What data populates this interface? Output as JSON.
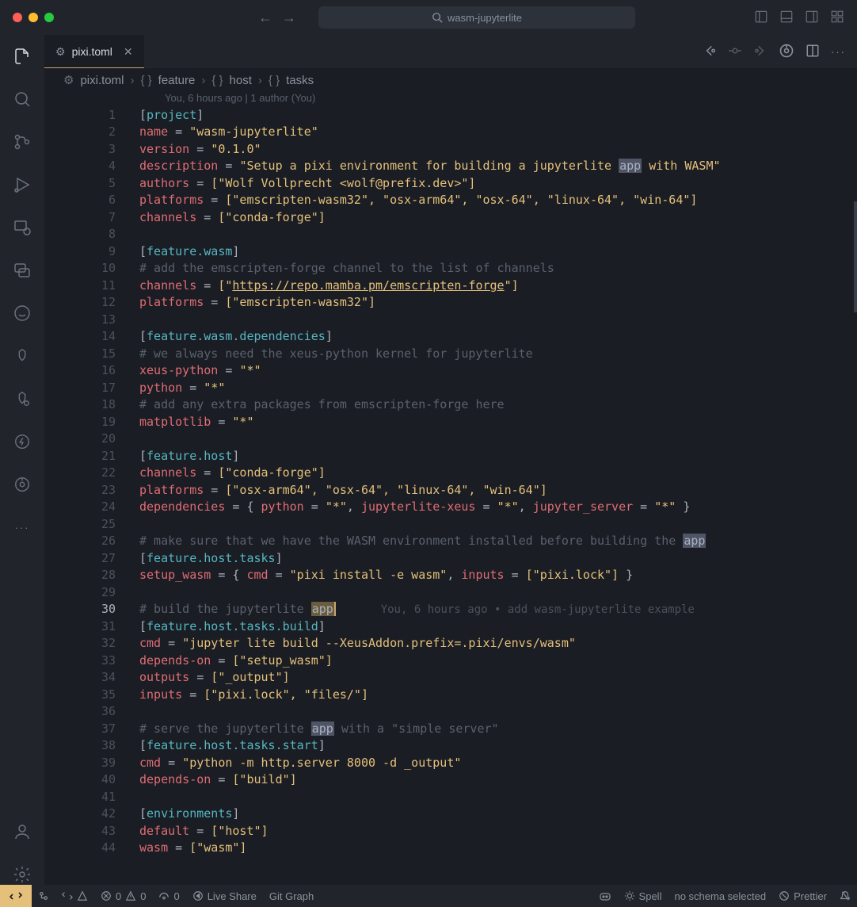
{
  "titlebar": {
    "search_text": "wasm-jupyterlite"
  },
  "tab": {
    "filename": "pixi.toml",
    "close_glyph": "✕"
  },
  "breadcrumb": {
    "items": [
      "pixi.toml",
      "feature",
      "host",
      "tasks"
    ],
    "sep": "›"
  },
  "blame": {
    "top": "You, 6 hours ago | 1 author (You)",
    "inline_author": "You, 6 hours ago",
    "inline_sep": "•",
    "inline_msg": "add wasm-jupyterlite example"
  },
  "statusbar": {
    "errors": "0",
    "warnings": "0",
    "ports": "0",
    "liveshare": "Live Share",
    "gitgraph": "Git Graph",
    "spell": "Spell",
    "schema": "no schema selected",
    "prettier": "Prettier"
  },
  "code": {
    "lines": [
      {
        "n": 1,
        "t": "section",
        "parts": [
          "[",
          "project",
          "]"
        ]
      },
      {
        "n": 2,
        "t": "kv",
        "key": "name",
        "val": "\"wasm-jupyterlite\""
      },
      {
        "n": 3,
        "t": "kv",
        "key": "version",
        "val": "\"0.1.0\""
      },
      {
        "n": 4,
        "t": "kv_app",
        "key": "description",
        "pre": "\"Setup a pixi environment for building a jupyterlite ",
        "app": "app",
        "post": " with WASM\""
      },
      {
        "n": 5,
        "t": "kv",
        "key": "authors",
        "val": "[\"Wolf Vollprecht <wolf@prefix.dev>\"]"
      },
      {
        "n": 6,
        "t": "kv",
        "key": "platforms",
        "val": "[\"emscripten-wasm32\", \"osx-arm64\", \"osx-64\", \"linux-64\", \"win-64\"]"
      },
      {
        "n": 7,
        "t": "kv",
        "key": "channels",
        "val": "[\"conda-forge\"]"
      },
      {
        "n": 8,
        "t": "blank"
      },
      {
        "n": 9,
        "t": "section",
        "parts": [
          "[",
          "feature.wasm",
          "]"
        ]
      },
      {
        "n": 10,
        "t": "comment",
        "text": "# add the emscripten-forge channel to the list of channels"
      },
      {
        "n": 11,
        "t": "kv_url",
        "key": "channels",
        "pre": "[\"",
        "url": "https://repo.mamba.pm/emscripten-forge",
        "post": "\"]"
      },
      {
        "n": 12,
        "t": "kv",
        "key": "platforms",
        "val": "[\"emscripten-wasm32\"]"
      },
      {
        "n": 13,
        "t": "blank"
      },
      {
        "n": 14,
        "t": "section",
        "parts": [
          "[",
          "feature.wasm.dependencies",
          "]"
        ]
      },
      {
        "n": 15,
        "t": "comment",
        "text": "# we always need the xeus-python kernel for jupyterlite"
      },
      {
        "n": 16,
        "t": "kv",
        "key": "xeus-python",
        "val": "\"*\""
      },
      {
        "n": 17,
        "t": "kv",
        "key": "python",
        "val": "\"*\""
      },
      {
        "n": 18,
        "t": "comment",
        "text": "# add any extra packages from emscripten-forge here"
      },
      {
        "n": 19,
        "t": "kv",
        "key": "matplotlib",
        "val": "\"*\""
      },
      {
        "n": 20,
        "t": "blank"
      },
      {
        "n": 21,
        "t": "section",
        "parts": [
          "[",
          "feature.host",
          "]"
        ]
      },
      {
        "n": 22,
        "t": "kv",
        "key": "channels",
        "val": "[\"conda-forge\"]"
      },
      {
        "n": 23,
        "t": "kv",
        "key": "platforms",
        "val": "[\"osx-arm64\", \"osx-64\", \"linux-64\", \"win-64\"]"
      },
      {
        "n": 24,
        "t": "kv_inline",
        "key": "dependencies",
        "pairs": [
          [
            "python",
            "\"*\""
          ],
          [
            "jupyterlite-xeus",
            "\"*\""
          ],
          [
            "jupyter_server",
            "\"*\""
          ]
        ]
      },
      {
        "n": 25,
        "t": "blank"
      },
      {
        "n": 26,
        "t": "comment_app",
        "pre": "# make sure that we have the WASM environment installed before building the ",
        "app": "app"
      },
      {
        "n": 27,
        "t": "section",
        "parts": [
          "[",
          "feature.host.tasks",
          "]"
        ]
      },
      {
        "n": 28,
        "t": "kv_inline",
        "key": "setup_wasm",
        "pairs": [
          [
            "cmd",
            "\"pixi install -e wasm\""
          ],
          [
            "inputs",
            "[\"pixi.lock\"]"
          ]
        ]
      },
      {
        "n": 29,
        "t": "blank"
      },
      {
        "n": 30,
        "t": "comment_app_cursor",
        "pre": "# build the jupyterlite ",
        "app": "app",
        "blame": true,
        "current": true
      },
      {
        "n": 31,
        "t": "section",
        "parts": [
          "[",
          "feature.host.tasks.build",
          "]"
        ]
      },
      {
        "n": 32,
        "t": "kv",
        "key": "cmd",
        "val": "\"jupyter lite build --XeusAddon.prefix=.pixi/envs/wasm\""
      },
      {
        "n": 33,
        "t": "kv",
        "key": "depends-on",
        "val": "[\"setup_wasm\"]"
      },
      {
        "n": 34,
        "t": "kv",
        "key": "outputs",
        "val": "[\"_output\"]"
      },
      {
        "n": 35,
        "t": "kv",
        "key": "inputs",
        "val": "[\"pixi.lock\", \"files/\"]"
      },
      {
        "n": 36,
        "t": "blank"
      },
      {
        "n": 37,
        "t": "comment_app",
        "pre": "# serve the jupyterlite ",
        "app": "app",
        "post": " with a \"simple server\""
      },
      {
        "n": 38,
        "t": "section",
        "parts": [
          "[",
          "feature.host.tasks.start",
          "]"
        ]
      },
      {
        "n": 39,
        "t": "kv",
        "key": "cmd",
        "val": "\"python -m http.server 8000 -d _output\""
      },
      {
        "n": 40,
        "t": "kv",
        "key": "depends-on",
        "val": "[\"build\"]"
      },
      {
        "n": 41,
        "t": "blank"
      },
      {
        "n": 42,
        "t": "section",
        "parts": [
          "[",
          "environments",
          "]"
        ]
      },
      {
        "n": 43,
        "t": "kv",
        "key": "default",
        "val": "[\"host\"]"
      },
      {
        "n": 44,
        "t": "kv",
        "key": "wasm",
        "val": "[\"wasm\"]"
      }
    ]
  }
}
